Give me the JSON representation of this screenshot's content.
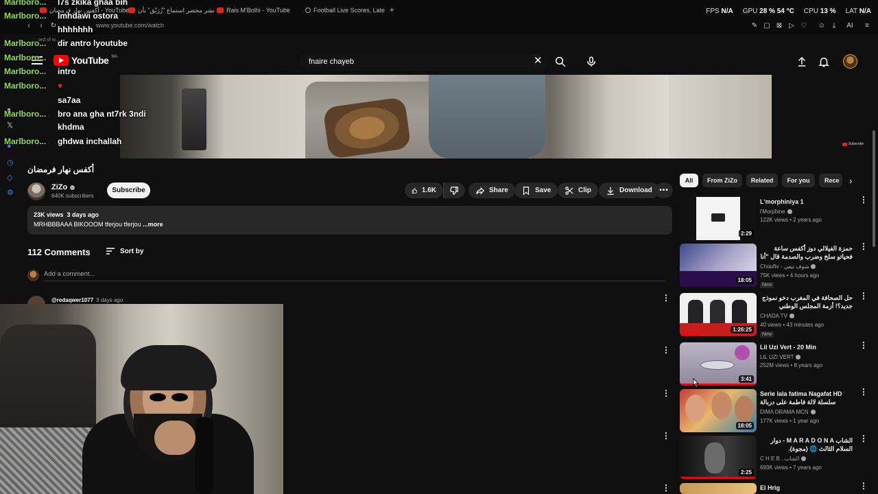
{
  "browser": {
    "tabs": [
      {
        "label": "أكفس نهار فرمضان - YouTube",
        "icon": "youtube-icon"
      },
      {
        "label": "نشر محضر استماع \"زُرَيْق\" بأن",
        "icon": "youtube-icon"
      },
      {
        "label": "Rais M'Bolhi - YouTube",
        "icon": "youtube-icon"
      },
      {
        "label": "Football Live Scores, Late",
        "icon": "globe-icon"
      }
    ],
    "new_tab": "+",
    "url": "www.youtube.com/watch",
    "perf": {
      "fps_label": "FPS",
      "fps_value": "N/A",
      "gpu_label": "GPU",
      "gpu_value": "28 % 54 °C",
      "cpu_label": "CPU",
      "cpu_value": "13 %",
      "lat_label": "LAT",
      "lat_value": "N/A"
    },
    "toolbar_ai": "AI",
    "bookmark_hint": "ord of w..."
  },
  "chat": [
    {
      "user": "Marlboro...",
      "msg": "l7s zkika ghaa bih"
    },
    {
      "user": "Marlboro...",
      "msg": "lmhdawi ostora"
    },
    {
      "user": "",
      "msg": "hhhhhhh"
    },
    {
      "user": "Marlboro...",
      "msg": "dir antro lyoutube"
    },
    {
      "user": "Marlboro...",
      "msg": ""
    },
    {
      "user": "Marlboro...",
      "msg": "intro"
    },
    {
      "user": "Marlboro...",
      "msg": ""
    },
    {
      "user": "",
      "msg": "sa7aa"
    },
    {
      "user": "Marlboro...",
      "msg": "bro ana gha nt7rk 3ndi"
    },
    {
      "user": "",
      "msg": "khdma"
    },
    {
      "user": "Marlboro...",
      "msg": "ghdwa inchallah"
    }
  ],
  "header": {
    "logo_text": "YouTube",
    "logo_country": "MA",
    "search_value": "fnaire chayeb"
  },
  "video": {
    "title": "أكفس نهار فرمضان",
    "channel": "ZiZo",
    "subscribers": "640K subscribers",
    "subscribe_label": "Subscribe",
    "likes": "1.6K",
    "share_label": "Share",
    "save_label": "Save",
    "clip_label": "Clip",
    "download_label": "Download",
    "watermark": "Subscribe"
  },
  "description": {
    "views": "23K views",
    "age": "3 days ago",
    "text": "MRHBBBAAA BIKOOOM tferjou tferjou",
    "more": "...more"
  },
  "comments": {
    "count_label": "112 Comments",
    "sort_label": "Sort by",
    "add_placeholder": "Add a comment...",
    "first": {
      "author": "@redaqwer1077",
      "time": "3 days ago"
    }
  },
  "chips": [
    "All",
    "From ZiZo",
    "Related",
    "For you",
    "Rece"
  ],
  "suggestions": [
    {
      "title": "L'morphiniya 1",
      "channel": "l'Morphine",
      "meta": "122K views • 2 years ago",
      "duration": "2:29",
      "rtl": false,
      "new": ""
    },
    {
      "title": "حمزة الفيلالي دوز أكفس ساعة فحياتو سلخ وضرب والصدمة قال \"أنا موضني وصلني\"",
      "channel": "Chouftv - شوف تيفي",
      "meta": "75K views • 4 hours ago",
      "duration": "18:05",
      "rtl": true,
      "new": "New"
    },
    {
      "title": "حل الصحافة في المغرب دخو نموذج جديد؟! أزمة المجلس الوطني للصحافة بجدل الدعم!",
      "channel": "CHADA TV",
      "meta": "40 views • 43 minutes ago",
      "duration": "1:26:25",
      "rtl": true,
      "new": "New"
    },
    {
      "title": "Lil Uzi Vert - 20 Min",
      "channel": "LIL UZI VERT",
      "meta": "252M views • 8 years ago",
      "duration": "3:41",
      "rtl": false,
      "new": ""
    },
    {
      "title": "Serie lala fatima Nagafat HD سلسلة لالة فاطمة على دربالة نكافات",
      "channel": "DIMA DRAMA MCN",
      "meta": "177K views • 1 year ago",
      "duration": "18:05",
      "rtl": false,
      "new": ""
    },
    {
      "title": "الشاب M A R A D O N A - دوار السلام الثالث 🌐 (مجوة).",
      "channel": "C H E B . الشاب",
      "meta": "693K views • 7 years ago",
      "duration": "2:25",
      "rtl": true,
      "new": ""
    },
    {
      "title": "El Hrig",
      "channel": "",
      "meta": "",
      "duration": "",
      "rtl": false,
      "new": ""
    }
  ],
  "colors": {
    "accent": "#ff0000",
    "chat_user": "#8fe04b",
    "bg": "#0f0f0f",
    "pill": "#272727"
  }
}
